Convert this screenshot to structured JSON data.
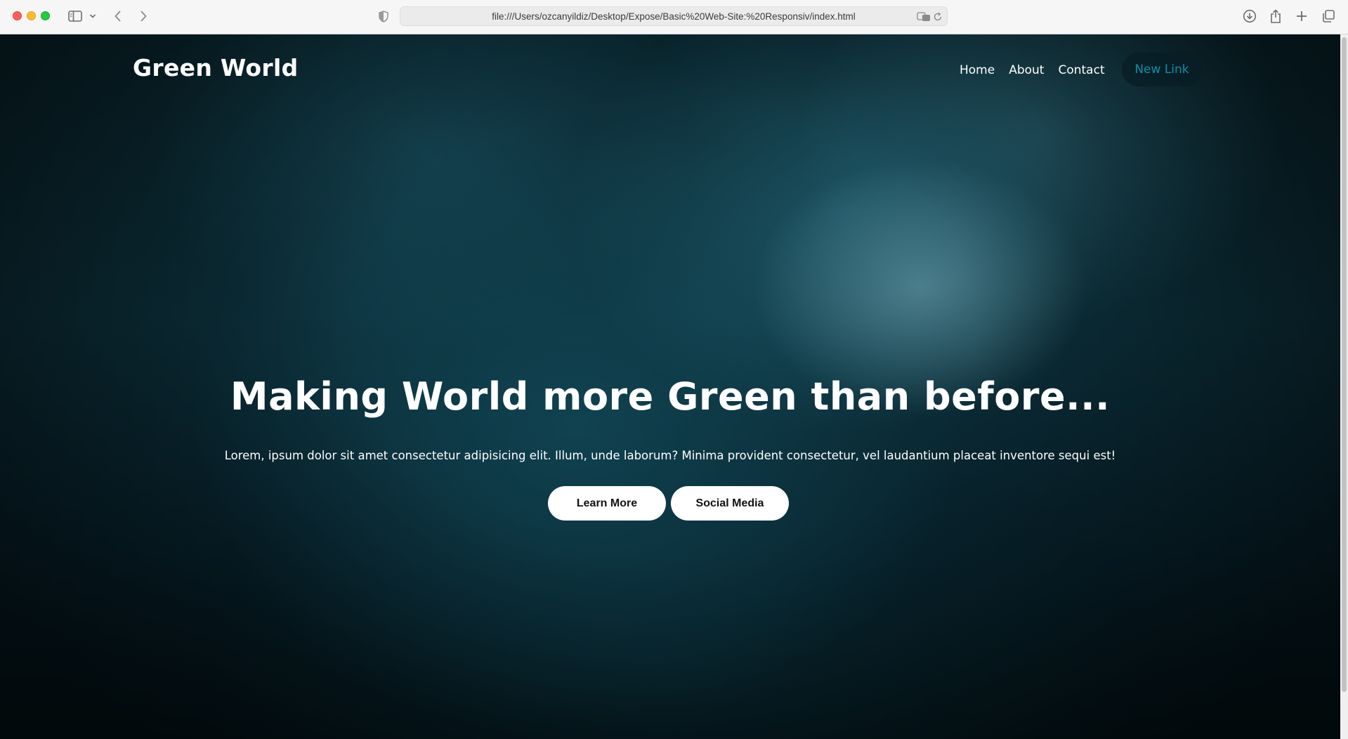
{
  "browser": {
    "url": "file:///Users/ozcanyildiz/Desktop/Expose/Basic%20Web-Site:%20Responsiv/index.html"
  },
  "site": {
    "brand": "Green World",
    "nav": {
      "home": "Home",
      "about": "About",
      "contact": "Contact",
      "new_link": "New Link"
    },
    "hero": {
      "title": "Making World more Green than before...",
      "subtitle": "Lorem, ipsum dolor sit amet consectetur adipisicing elit. Illum, unde laborum? Minima provident consectetur, vel laudantium placeat inventore sequi est!",
      "learn_more": "Learn More",
      "social_media": "Social Media"
    }
  },
  "colors": {
    "new_link_accent": "#0f8fa8",
    "button_bg": "#ffffff"
  }
}
